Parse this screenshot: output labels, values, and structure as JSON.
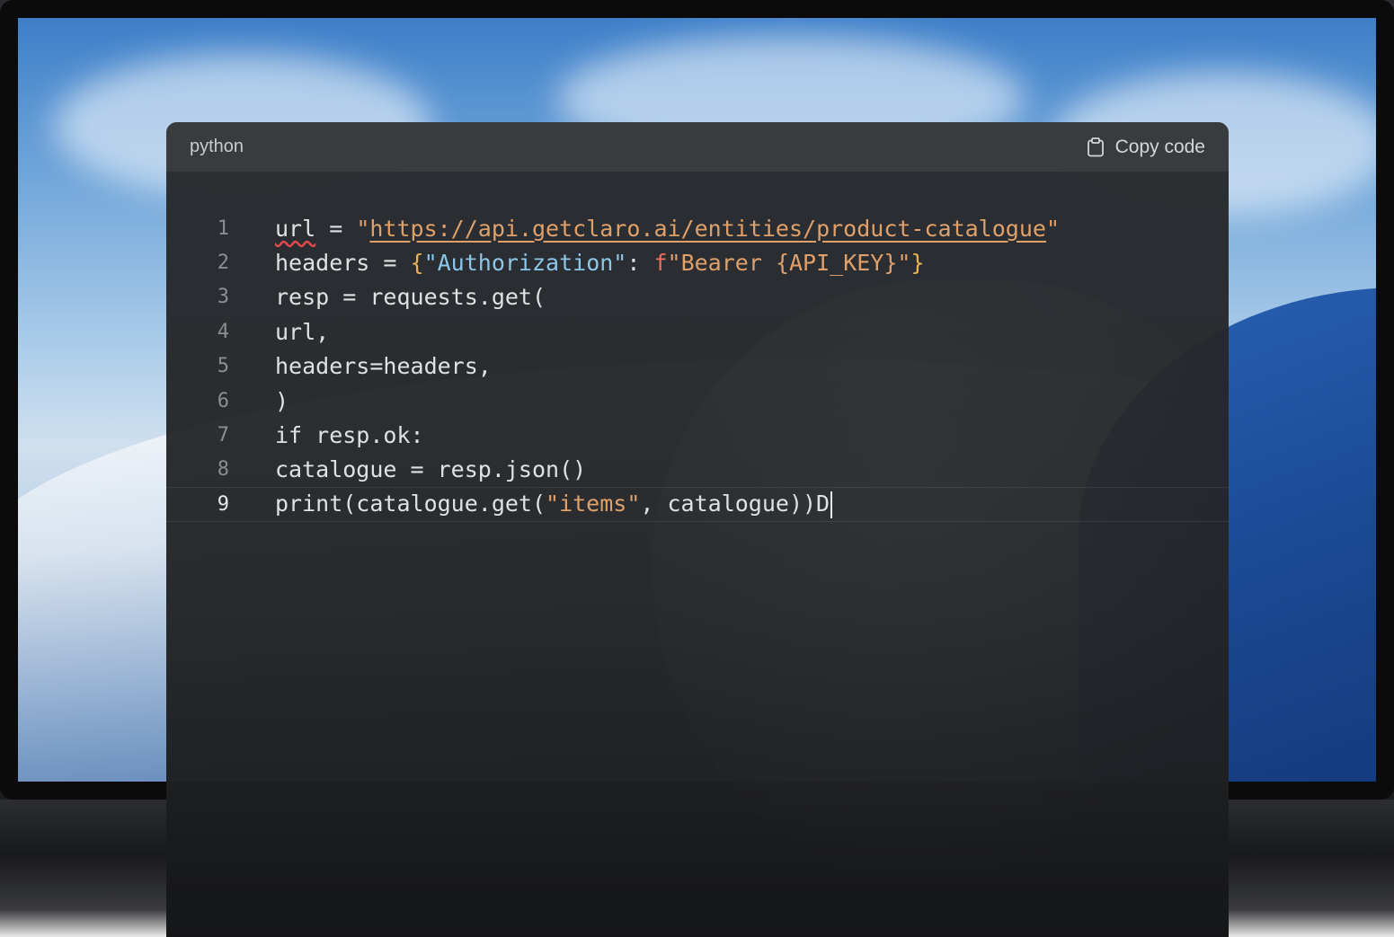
{
  "code_block": {
    "language": "python",
    "copy_label": "Copy code",
    "copy_icon": "clipboard-icon",
    "active_line": 9,
    "lines": [
      {
        "number": "1",
        "tokens": [
          {
            "text": "url",
            "class": "tok-err"
          },
          {
            "text": " = ",
            "class": ""
          },
          {
            "text": "\"",
            "class": "tok-str"
          },
          {
            "text": "https://api.getclaro.ai/entities/product-catalogue",
            "class": "tok-url"
          },
          {
            "text": "\"",
            "class": "tok-str"
          }
        ]
      },
      {
        "number": "2",
        "tokens": [
          {
            "text": "headers = ",
            "class": ""
          },
          {
            "text": "{",
            "class": "tok-brace"
          },
          {
            "text": "\"Authorization\"",
            "class": "tok-key"
          },
          {
            "text": ": ",
            "class": ""
          },
          {
            "text": "f",
            "class": "tok-fprefix"
          },
          {
            "text": "\"Bearer ",
            "class": "tok-str"
          },
          {
            "text": "{API_KEY}",
            "class": "tok-str"
          },
          {
            "text": "\"",
            "class": "tok-str"
          },
          {
            "text": "}",
            "class": "tok-brace"
          }
        ]
      },
      {
        "number": "3",
        "tokens": [
          {
            "text": "resp = requests.get(",
            "class": ""
          }
        ]
      },
      {
        "number": "4",
        "tokens": [
          {
            "text": "url,",
            "class": ""
          }
        ]
      },
      {
        "number": "5",
        "tokens": [
          {
            "text": "headers=headers,",
            "class": ""
          }
        ]
      },
      {
        "number": "6",
        "tokens": [
          {
            "text": ")",
            "class": ""
          }
        ]
      },
      {
        "number": "7",
        "tokens": [
          {
            "text": "if resp.ok:",
            "class": ""
          }
        ]
      },
      {
        "number": "8",
        "tokens": [
          {
            "text": "catalogue = resp.json()",
            "class": ""
          }
        ]
      },
      {
        "number": "9",
        "tokens": [
          {
            "text": "print(catalogue.get(",
            "class": ""
          },
          {
            "text": "\"items\"",
            "class": "tok-str"
          },
          {
            "text": ", catalogue))D",
            "class": ""
          }
        ]
      }
    ]
  }
}
